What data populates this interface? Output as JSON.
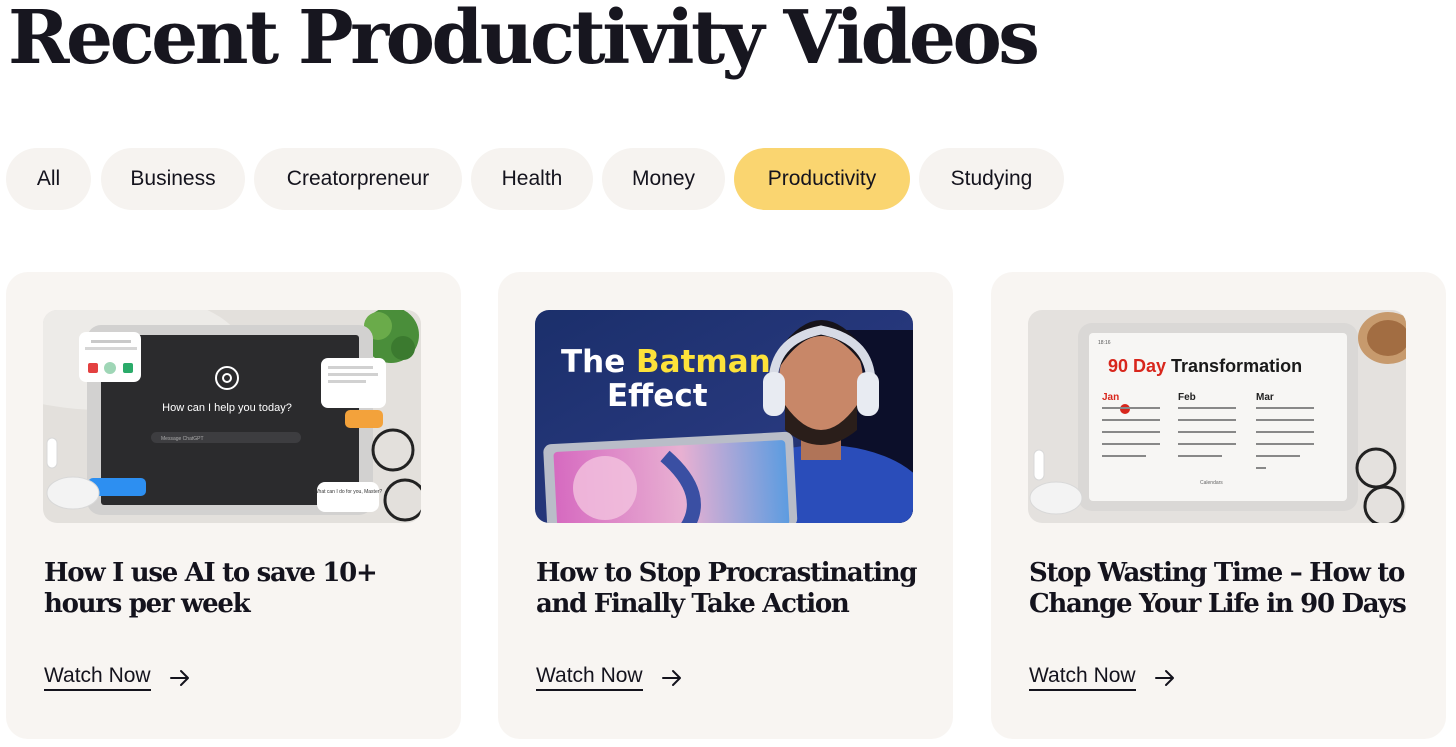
{
  "page": {
    "title": "Recent Productivity Videos"
  },
  "filters": [
    {
      "label": "All",
      "active": false
    },
    {
      "label": "Business",
      "active": false
    },
    {
      "label": "Creatorpreneur",
      "active": false
    },
    {
      "label": "Health",
      "active": false
    },
    {
      "label": "Money",
      "active": false
    },
    {
      "label": "Productivity",
      "active": true
    },
    {
      "label": "Studying",
      "active": false
    }
  ],
  "colors": {
    "active_filter": "#fad570",
    "pill_bg": "#f6f3f0",
    "card_bg": "#f8f5f2",
    "text": "#14131d",
    "highlight_red": "#d8261c",
    "highlight_yellow": "#fde23a"
  },
  "cards": [
    {
      "title": "How I use AI to save 10+ hours per week",
      "cta": "Watch Now",
      "cta_icon": "arrow-right-icon",
      "thumbnail": {
        "icon": "openai-logo-icon",
        "prompt": "How can I help you today?",
        "input_placeholder": "Message ChatGPT",
        "bubble_text": "What can I do for you, Master?"
      }
    },
    {
      "title": "How to Stop Procrastinating and Finally Take Action",
      "cta": "Watch Now",
      "cta_icon": "arrow-right-icon",
      "thumbnail": {
        "overlay_prefix": "The ",
        "overlay_highlight": "Batman",
        "overlay_line2": "Effect"
      }
    },
    {
      "title": "Stop Wasting Time – How to Change Your Life in 90 Days",
      "cta": "Watch Now",
      "cta_icon": "arrow-right-icon",
      "thumbnail": {
        "status_time": "18:16",
        "highlight": "90 Day",
        "heading_rest": " Transformation",
        "months": [
          "Jan",
          "Feb",
          "Mar"
        ],
        "footer": "Calendars"
      }
    }
  ]
}
